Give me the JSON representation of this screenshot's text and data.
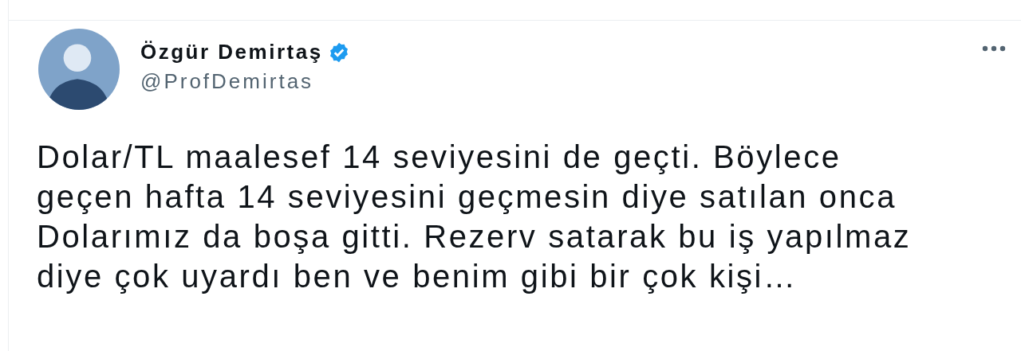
{
  "author": {
    "name": "Özgür Demirtaş",
    "verified": true,
    "handle": "@ProfDemirtas"
  },
  "tweet": {
    "text_lines": [
      "Dolar/TL maalesef 14 seviyesini de geçti. Böylece",
      "geçen hafta 14 seviyesini geçmesin diye satılan onca",
      "Dolarımız da boşa gitti. Rezerv satarak bu iş yapılmaz",
      "diye çok uyardı ben ve benim gibi bir çok kişi…"
    ]
  }
}
